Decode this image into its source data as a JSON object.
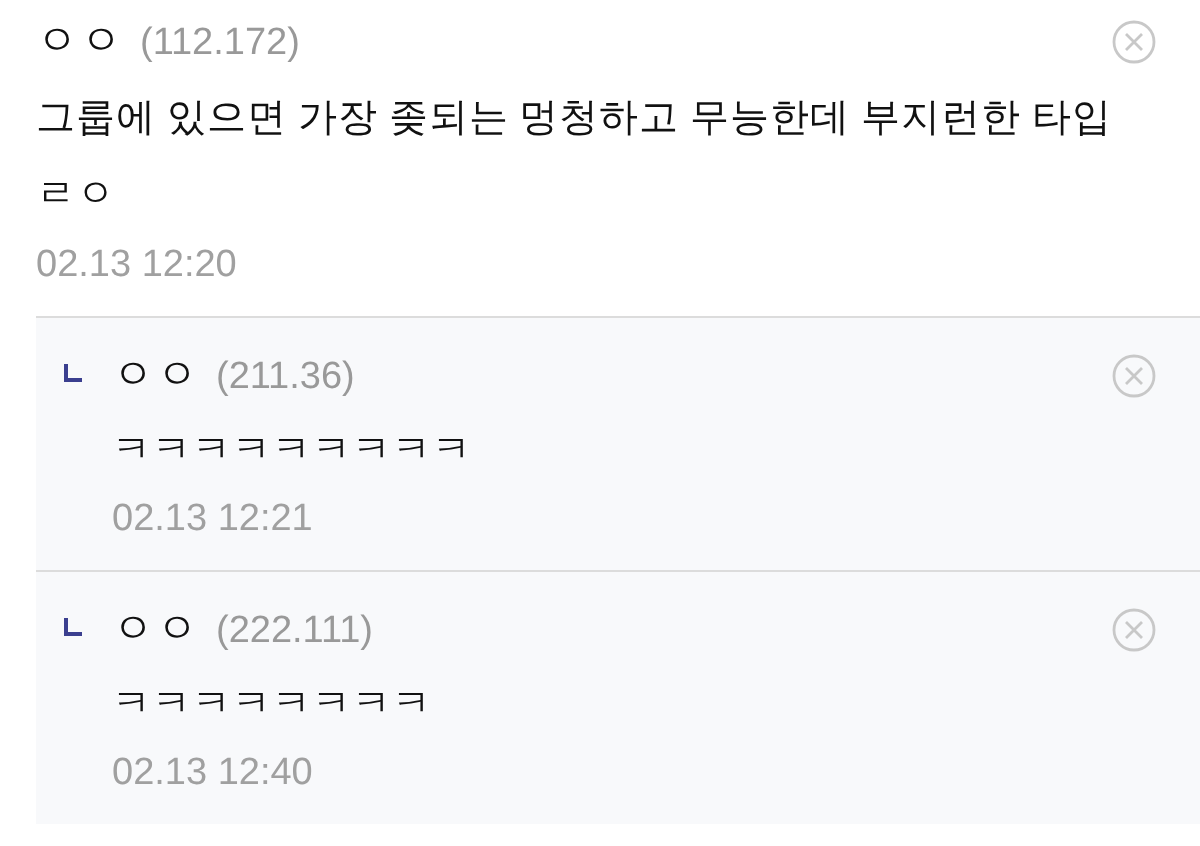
{
  "comments": [
    {
      "kind": "comment",
      "name": "ㅇㅇ",
      "ip": "(112.172)",
      "text": "그룹에 있으면 가장 좆되는 멍청하고 무능한데 부지런한 타입 ㄹㅇ",
      "date": "02.13 12:20"
    },
    {
      "kind": "reply",
      "name": "ㅇㅇ",
      "ip": "(211.36)",
      "text": "ㅋㅋㅋㅋㅋㅋㅋㅋㅋ",
      "date": "02.13 12:21"
    },
    {
      "kind": "reply",
      "name": "ㅇㅇ",
      "ip": "(222.111)",
      "text": "ㅋㅋㅋㅋㅋㅋㅋㅋ",
      "date": "02.13 12:40"
    }
  ]
}
